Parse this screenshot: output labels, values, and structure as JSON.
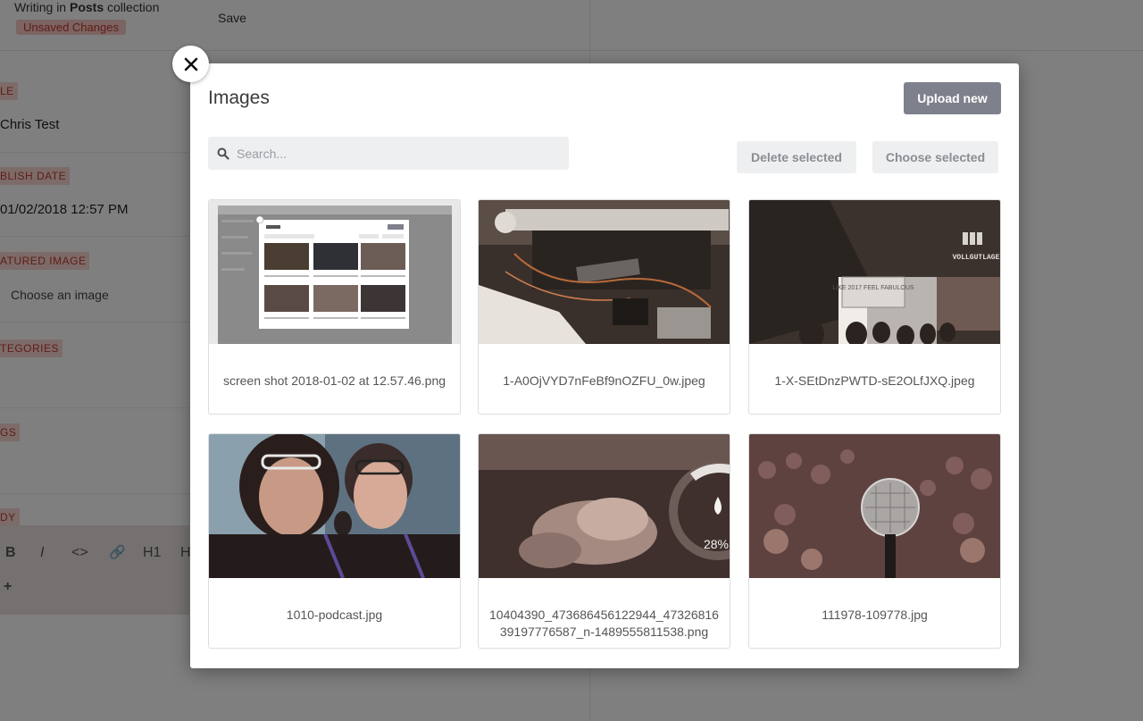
{
  "editor": {
    "writing_prefix": "Writing in",
    "collection_name": "Posts",
    "writing_suffix": "collection",
    "unsaved_badge": "Unsaved Changes",
    "save_label": "Save",
    "fields": {
      "title_label": "LE",
      "title_value": "Chris Test",
      "date_label": "BLISH DATE",
      "date_value": "01/02/2018 12:57 PM",
      "image_label": "ATURED IMAGE",
      "image_link": "Choose an image",
      "categories_label": "TEGORIES",
      "tags_label": "GS",
      "body_label": "DY"
    },
    "toolbar": [
      "B",
      "I",
      "<>",
      "🔗",
      "H1",
      "H",
      "+"
    ]
  },
  "modal": {
    "title": "Images",
    "upload_label": "Upload new",
    "search_placeholder": "Search...",
    "delete_label": "Delete selected",
    "choose_label": "Choose selected",
    "images": [
      {
        "name": "screen shot 2018-01-02 at 12.57.46.png"
      },
      {
        "name": "1-A0OjVYD7nFeBf9nOZFU_0w.jpeg"
      },
      {
        "name": "1-X-SEtDnzPWTD-sE2OLfJXQ.jpeg"
      },
      {
        "name": "1010-podcast.jpg"
      },
      {
        "name": "10404390_473686456122944_4732681639197776587_n-1489555811538.png"
      },
      {
        "name": "111978-109778.jpg"
      }
    ],
    "thumb_text": {
      "sign_brand": "VOLLGUTLAGE",
      "sign_text": "LIKE 2017 FEEL FABULOUS",
      "gauge_percent": "28%"
    }
  }
}
